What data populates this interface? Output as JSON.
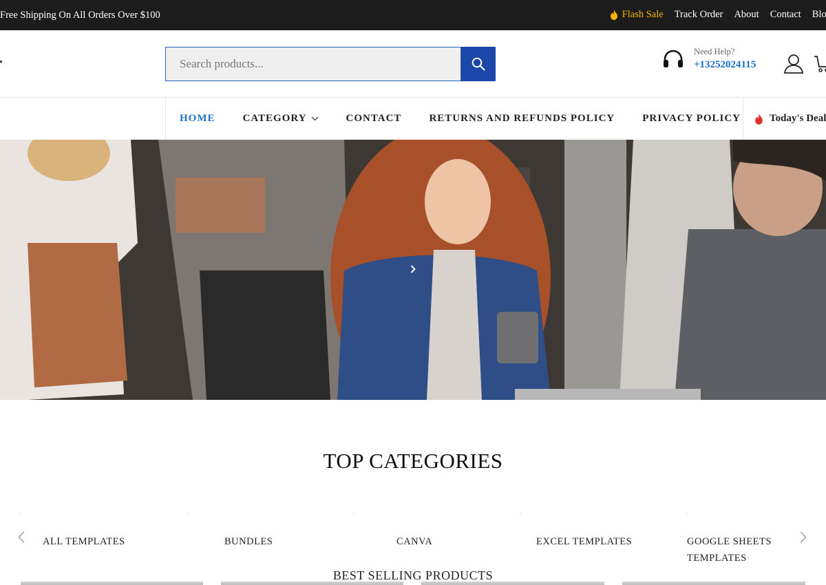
{
  "topbar": {
    "shipping_text": "Free Shipping On All Orders Over $100",
    "links": [
      {
        "label": "Flash Sale",
        "icon": "flame-icon",
        "color": "#f5b400"
      },
      {
        "label": "Track Order"
      },
      {
        "label": "About"
      },
      {
        "label": "Contact"
      },
      {
        "label": "Blog"
      }
    ]
  },
  "header": {
    "search": {
      "placeholder": "Search products...",
      "button_icon": "search-icon"
    },
    "help": {
      "label": "Need Help?",
      "phone": "+13252024115",
      "icon": "headset-icon"
    },
    "account_icon": "user-icon",
    "cart_icon": "cart-icon"
  },
  "nav": {
    "items": [
      {
        "label": "HOME",
        "active": true
      },
      {
        "label": "CATEGORY",
        "has_dropdown": true
      },
      {
        "label": "CONTACT"
      },
      {
        "label": "RETURNS AND REFUNDS POLICY"
      },
      {
        "label": "PRIVACY POLICY"
      }
    ],
    "deals_label": "Today's Deal"
  },
  "hero": {
    "next_icon": "chevron-right-icon"
  },
  "top_categories": {
    "title": "TOP CATEGORIES",
    "items": [
      {
        "label": "ALL TEMPLATES"
      },
      {
        "label": "BUNDLES"
      },
      {
        "label": "CANVA"
      },
      {
        "label": "EXCEL TEMPLATES"
      },
      {
        "label": "GOOGLE SHEETS TEMPLATES"
      }
    ]
  },
  "best_selling": {
    "title": "BEST SELLING PRODUCTS"
  },
  "colors": {
    "accent": "#1b6fc9",
    "search_button": "#1a47a8",
    "flash": "#f5b400",
    "topbar": "#1c1c1c"
  }
}
